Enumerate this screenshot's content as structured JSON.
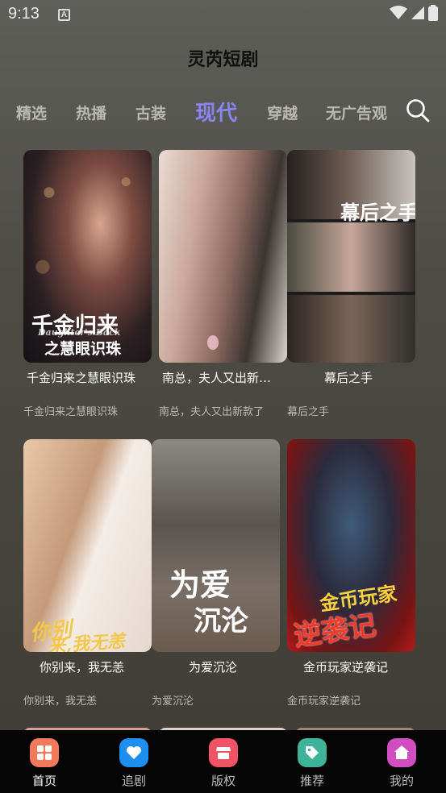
{
  "status_bar": {
    "time": "9:13",
    "notif_letter": "A"
  },
  "app": {
    "title": "灵芮短剧"
  },
  "tabs": [
    "精选",
    "热播",
    "古装",
    "现代",
    "穿越",
    "无广告观"
  ],
  "active_tab": "现代",
  "cards": [
    {
      "title": "千金归来之慧眼识珠",
      "subtitle": "千金归来之慧眼识珠",
      "poster_text": [
        "千金归来",
        "之慧眼识珠"
      ],
      "poster_sub": "Daughter's Back"
    },
    {
      "title": "南总，夫人又出新…",
      "subtitle": "南总，夫人又出新款了",
      "poster_text": []
    },
    {
      "title": "幕后之手",
      "subtitle": "幕后之手",
      "poster_text": [
        "幕后之手"
      ]
    },
    {
      "title": "你别来，我无恙",
      "subtitle": "你别来，我无恙",
      "poster_text": [
        "你别",
        "来,我无恙"
      ]
    },
    {
      "title": "为爱沉沦",
      "subtitle": "为爱沉沦",
      "poster_text": [
        "为爱",
        "沉沦"
      ]
    },
    {
      "title": "金币玩家逆袭记",
      "subtitle": "金币玩家逆袭记",
      "poster_text": [
        "金币玩家",
        "逆袭记"
      ]
    }
  ],
  "bottom_nav": [
    {
      "label": "首页",
      "icon": "home-grid-icon",
      "color": "#f07a5a"
    },
    {
      "label": "追剧",
      "icon": "heart-icon",
      "color": "#1e8ff0"
    },
    {
      "label": "版权",
      "icon": "store-icon",
      "color": "#f05366"
    },
    {
      "label": "推荐",
      "icon": "tag-icon",
      "color": "#3fb39a"
    },
    {
      "label": "我的",
      "icon": "house-icon",
      "color": "#d04ec0"
    }
  ],
  "active_nav": "首页"
}
